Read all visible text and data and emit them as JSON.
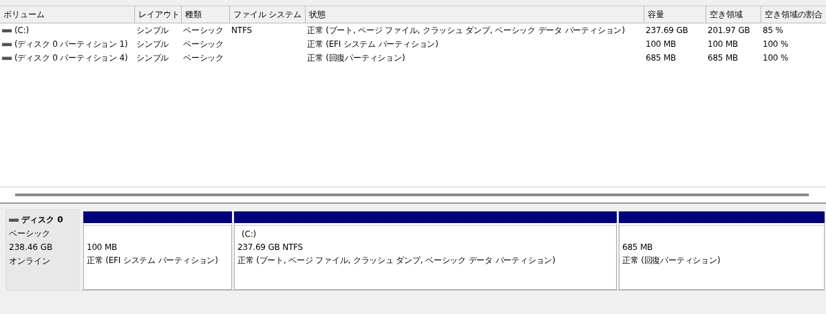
{
  "volume_list": {
    "columns": [
      "ボリューム",
      "レイアウト",
      "種類",
      "ファイル システム",
      "状態",
      "容量",
      "空き領域",
      "空き領域の割合"
    ],
    "rows": [
      {
        "cells": [
          "(C:)",
          "シンプル",
          "ベーシック",
          "NTFS",
          "正常 (ブート, ページ ファイル, クラッシュ ダンプ, ベーシック データ パーティション)",
          "237.69 GB",
          "201.97 GB",
          "85 %"
        ]
      },
      {
        "cells": [
          "(ディスク 0 パーティション 1)",
          "シンプル",
          "ベーシック",
          "",
          "正常 (EFI システム パーティション)",
          "100 MB",
          "100 MB",
          "100 %"
        ]
      },
      {
        "cells": [
          "(ディスク 0 パーティション 4)",
          "シンプル",
          "ベーシック",
          "",
          "正常 (回復パーティション)",
          "685 MB",
          "685 MB",
          "100 %"
        ]
      }
    ]
  },
  "disk": {
    "name": "ディスク 0",
    "type": "ベーシック",
    "size": "238.46 GB",
    "status": "オンライン",
    "partitions": [
      {
        "size": "100 MB",
        "status": "正常 (EFI システム パーティション)"
      },
      {
        "label": "(C:)",
        "size": "237.69 GB NTFS",
        "status": "正常 (ブート, ページ ファイル, クラッシュ ダンプ, ベーシック データ パーティション)"
      },
      {
        "size": "685 MB",
        "status": "正常 (回復パーティション)"
      }
    ]
  }
}
